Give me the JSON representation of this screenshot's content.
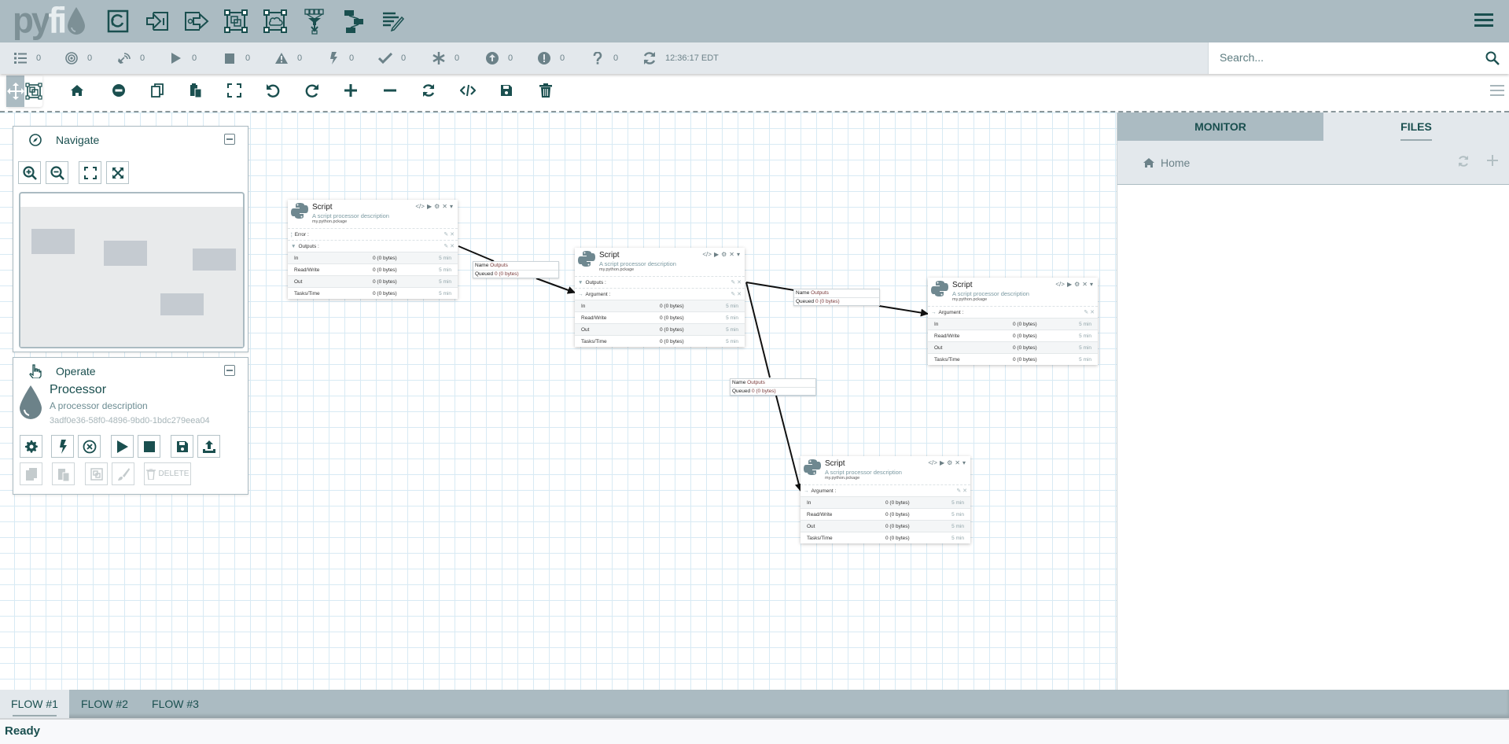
{
  "app": {
    "logo_left": "py",
    "logo_right": "fi"
  },
  "topbar": {
    "icons": [
      "processor-icon",
      "input-port-icon",
      "output-port-icon",
      "process-group-icon",
      "remote-group-icon",
      "funnel-icon",
      "flow-tree-icon",
      "notes-icon"
    ]
  },
  "status": {
    "items": [
      {
        "icon": "list-icon",
        "value": "0"
      },
      {
        "icon": "target-icon",
        "value": "0"
      },
      {
        "icon": "satellite-icon",
        "value": "0"
      },
      {
        "icon": "play-icon",
        "value": "0"
      },
      {
        "icon": "stop-icon",
        "value": "0"
      },
      {
        "icon": "warning-icon",
        "value": "0"
      },
      {
        "icon": "bolt-icon",
        "value": "0"
      },
      {
        "icon": "check-icon",
        "value": "0"
      },
      {
        "icon": "asterisk-icon",
        "value": "0"
      },
      {
        "icon": "arrow-up-circle-icon",
        "value": "0"
      },
      {
        "icon": "exclamation-circle-icon",
        "value": "0"
      },
      {
        "icon": "question-icon",
        "value": "0"
      }
    ],
    "clock": "12:36:17 EDT"
  },
  "search": {
    "placeholder": "Search..."
  },
  "navigate": {
    "title": "Navigate"
  },
  "operate": {
    "title": "Operate",
    "processor_name": "Processor",
    "processor_desc": "A processor description",
    "processor_id": "3adf0e36-58f0-4896-9bd0-1bdc279eea04",
    "delete_label": "DELETE"
  },
  "processors": [
    {
      "name": "Script",
      "desc": "A script processor description",
      "pkg": "my.python.pckage",
      "sections": [
        "Error :",
        "Outputs :"
      ],
      "rows": [
        [
          "In",
          "0 (0 bytes)",
          "5 min"
        ],
        [
          "Read/Write",
          "0 (0 bytes)",
          "5 min"
        ],
        [
          "Out",
          "0 (0 bytes)",
          "5 min"
        ],
        [
          "Tasks/Time",
          "0 (0 bytes)",
          "5 min"
        ]
      ]
    },
    {
      "name": "Script",
      "desc": "A script processor description",
      "pkg": "my.python.pckage",
      "sections": [
        "Outputs :",
        "Argument :"
      ],
      "rows": [
        [
          "In",
          "0 (0 bytes)",
          "5 min"
        ],
        [
          "Read/Write",
          "0 (0 bytes)",
          "5 min"
        ],
        [
          "Out",
          "0 (0 bytes)",
          "5 min"
        ],
        [
          "Tasks/Time",
          "0 (0 bytes)",
          "5 min"
        ]
      ]
    },
    {
      "name": "Script",
      "desc": "A script processor description",
      "pkg": "my.python.pckage",
      "sections": [
        "Argument :"
      ],
      "rows": [
        [
          "In",
          "0 (0 bytes)",
          "5 min"
        ],
        [
          "Read/Write",
          "0 (0 bytes)",
          "5 min"
        ],
        [
          "Out",
          "0 (0 bytes)",
          "5 min"
        ],
        [
          "Tasks/Time",
          "0 (0 bytes)",
          "5 min"
        ]
      ]
    },
    {
      "name": "Script",
      "desc": "A script processor description",
      "pkg": "my.python.pckage",
      "sections": [
        "Argument :"
      ],
      "rows": [
        [
          "In",
          "0 (0 bytes)",
          "5 min"
        ],
        [
          "Read/Write",
          "0 (0 bytes)",
          "5 min"
        ],
        [
          "Out",
          "0 (0 bytes)",
          "5 min"
        ],
        [
          "Tasks/Time",
          "0 (0 bytes)",
          "5 min"
        ]
      ]
    }
  ],
  "connections": [
    {
      "name_label": "Name",
      "name": "Outputs",
      "queued_label": "Queued",
      "queued": "0",
      "bytes": "(0 bytes)"
    },
    {
      "name_label": "Name",
      "name": "Outputs",
      "queued_label": "Queued",
      "queued": "0",
      "bytes": "(0 bytes)"
    },
    {
      "name_label": "Name",
      "name": "Outputs",
      "queued_label": "Queued",
      "queued": "0",
      "bytes": "(0 bytes)"
    }
  ],
  "right_panel": {
    "tabs": [
      "MONITOR",
      "FILES"
    ],
    "active_tab": "FILES",
    "breadcrumb": "Home"
  },
  "flows": {
    "tabs": [
      "FLOW #1",
      "FLOW #2",
      "FLOW #3"
    ],
    "active": "FLOW #1"
  },
  "statusline": {
    "text": "Ready"
  },
  "colors": {
    "primary": "#1a4f4f",
    "bar": "#abbbc2",
    "light": "#e3e8ec"
  }
}
